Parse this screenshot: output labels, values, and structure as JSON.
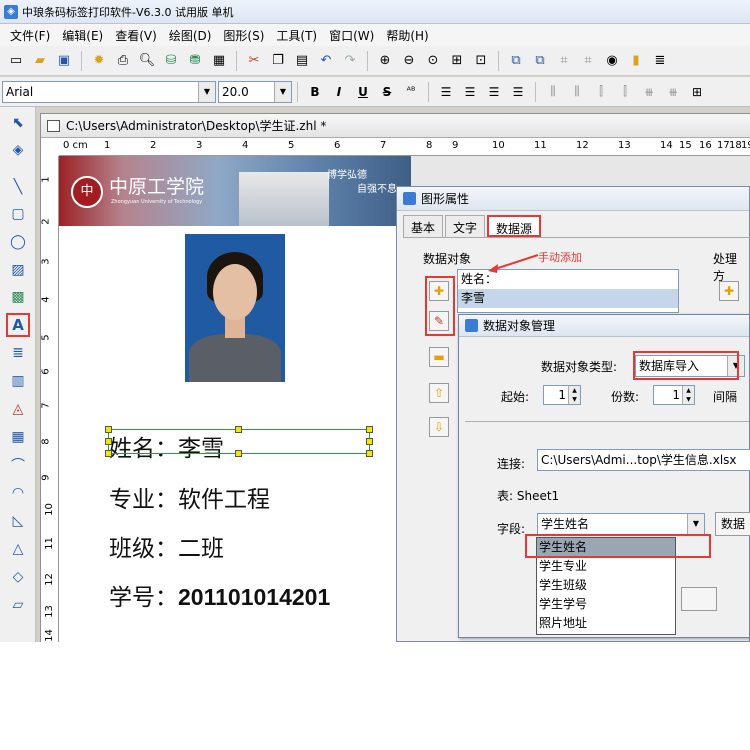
{
  "titlebar": {
    "title": "中琅条码标签打印软件-V6.3.0 试用版 单机"
  },
  "menu": [
    "文件(F)",
    "编辑(E)",
    "查看(V)",
    "绘图(D)",
    "图形(S)",
    "工具(T)",
    "窗口(W)",
    "帮助(H)"
  ],
  "fontbar": {
    "font_name": "Arial",
    "font_size": "20.0",
    "bold": "B",
    "italic": "I",
    "underline": "U",
    "strike": "S"
  },
  "document": {
    "path": "C:\\Users\\Administrator\\Desktop\\学生证.zhl *"
  },
  "ruler": {
    "h_ticks": [
      "0 cm",
      "1",
      "2",
      "3",
      "4",
      "5",
      "6",
      "7",
      "8",
      "9",
      "10",
      "11",
      "12",
      "13",
      "14",
      "15",
      "16",
      "17",
      "18",
      "19"
    ],
    "v_ticks": [
      "1",
      "2",
      "3",
      "4",
      "5",
      "6",
      "7",
      "8",
      "9",
      "10",
      "11",
      "12",
      "13",
      "14"
    ]
  },
  "card": {
    "university": "中原工学院",
    "university_en": "Zhongyuan University of Technology",
    "motto_line1": "博学弘德",
    "motto_line2": "自强不息",
    "name_field": "姓名：李雪",
    "major_field": "专业：软件工程",
    "class_field": "班级：二班",
    "id_label": "学号：",
    "id_value": "201101014201"
  },
  "prop_dialog": {
    "title": "图形属性",
    "tabs": [
      "基本",
      "文字",
      "数据源"
    ],
    "active_tab": "数据源",
    "data_objects_label": "数据对象",
    "processing_label": "处理方",
    "data_objects": [
      "姓名：",
      "李雪"
    ],
    "annotation": "手动添加"
  },
  "mgr_dialog": {
    "title": "数据对象管理",
    "type_label": "数据对象类型:",
    "type_value": "数据库导入",
    "start_label": "起始:",
    "start_value": "1",
    "copies_label": "份数:",
    "copies_value": "1",
    "interval_label": "间隔",
    "connect_label": "连接:",
    "connect_value": "C:\\Users\\Admi...top\\学生信息.xlsx",
    "table_label": "表: Sheet1",
    "field_label": "字段:",
    "field_value": "学生姓名",
    "field_btn": "数据",
    "field_options": [
      "学生姓名",
      "学生专业",
      "学生班级",
      "学生学号",
      "照片地址"
    ]
  },
  "colors": {
    "highlight": "#e53935",
    "selection_border": "#2a9d3a",
    "handle": "#f5e600"
  }
}
